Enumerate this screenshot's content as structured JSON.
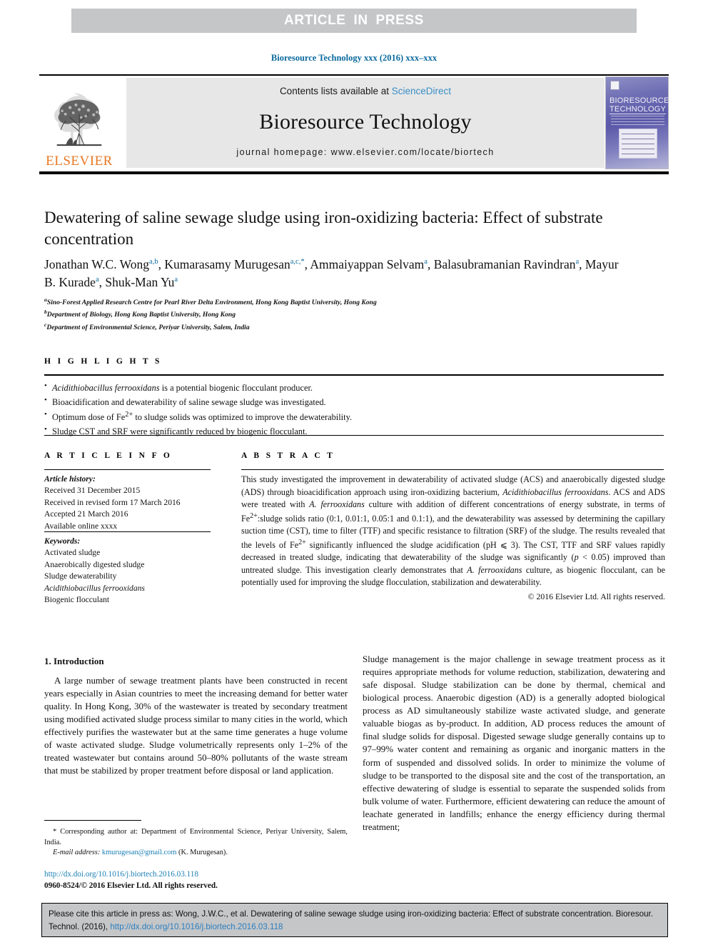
{
  "banner": {
    "text": "ARTICLE  IN  PRESS",
    "bg_color": "#c5c6c8"
  },
  "journal_ref": {
    "text": "Bioresource Technology xxx (2016) xxx–xxx",
    "color": "#0b6a9e"
  },
  "masthead": {
    "publisher_name": "ELSEVIER",
    "publisher_color": "#e87722",
    "contents_prefix": "Contents lists available at ",
    "contents_link": "ScienceDirect",
    "journal_title": "Bioresource Technology",
    "homepage": "journal homepage: www.elsevier.com/locate/biortech",
    "cover": {
      "line1": "BIORESOURCE",
      "line2": "TECHNOLOGY"
    }
  },
  "article": {
    "title": "Dewatering of saline sewage sludge using iron-oxidizing bacteria: Effect of substrate concentration",
    "authors": [
      {
        "name": "Jonathan W.C. Wong",
        "marks": "a,b",
        "sep": ", "
      },
      {
        "name": "Kumarasamy Murugesan",
        "marks": "a,c,*",
        "sep": ", "
      },
      {
        "name": "Ammaiyappan Selvam",
        "marks": "a",
        "sep": ", "
      },
      {
        "name": "Balasubramanian Ravindran",
        "marks": "a",
        "sep": ", "
      },
      {
        "name": "Mayur B. Kurade",
        "marks": "a",
        "sep": ", "
      },
      {
        "name": "Shuk-Man Yu",
        "marks": "a",
        "sep": ""
      }
    ],
    "affiliations": [
      {
        "mark": "a",
        "text": "Sino-Forest Applied Research Centre for Pearl River Delta Environment, Hong Kong Baptist University, Hong Kong"
      },
      {
        "mark": "b",
        "text": "Department of Biology, Hong Kong Baptist University, Hong Kong"
      },
      {
        "mark": "c",
        "text": "Department of Environmental Science, Periyar University, Salem, India"
      }
    ]
  },
  "highlights": {
    "heading": "H I G H L I G H T S",
    "items": [
      {
        "italic_lead": "Acidithiobacillus ferrooxidans",
        "rest": " is a potential biogenic flocculant producer."
      },
      {
        "italic_lead": "",
        "rest": "Bioacidification and dewaterability of saline sewage sludge was investigated."
      },
      {
        "italic_lead": "",
        "rest": "Optimum dose of Fe2+ to sludge solids was optimized to improve the dewaterability."
      },
      {
        "italic_lead": "",
        "rest": "Sludge CST and SRF were significantly reduced by biogenic flocculant."
      }
    ]
  },
  "article_info": {
    "heading": "A R T I C L E    I N F O",
    "history_label": "Article history:",
    "history": [
      "Received 31 December 2015",
      "Received in revised form 17 March 2016",
      "Accepted 21 March 2016",
      "Available online xxxx"
    ],
    "keywords_label": "Keywords:",
    "keywords": [
      "Activated sludge",
      "Anaerobically digested sludge",
      "Sludge dewaterability",
      "Acidithiobacillus ferrooxidans",
      "Biogenic flocculant"
    ],
    "italic_keyword": "Acidithiobacillus ferrooxidans"
  },
  "abstract": {
    "heading": "A B S T R A C T",
    "copyright": "© 2016 Elsevier Ltd. All rights reserved."
  },
  "introduction": {
    "section_title": "1. Introduction",
    "left_text": "A large number of sewage treatment plants have been constructed in recent years especially in Asian countries to meet the increasing demand for better water quality. In Hong Kong, 30% of the wastewater is treated by secondary treatment using modified activated sludge process similar to many cities in the world, which effectively purifies the wastewater but at the same time generates a huge volume of waste activated sludge. Sludge volumetrically represents only 1–2% of the treated wastewater but contains around 50–80% pollutants of the waste stream that must be stabilized by proper treatment before disposal or land application.",
    "right_text": "Sludge management is the major challenge in sewage treatment process as it requires appropriate methods for volume reduction, stabilization, dewatering and safe disposal. Sludge stabilization can be done by thermal, chemical and biological process. Anaerobic digestion (AD) is a generally adopted biological process as AD simultaneously stabilize waste activated sludge, and generate valuable biogas as by-product. In addition, AD process reduces the amount of final sludge solids for disposal. Digested sewage sludge generally contains up to 97–99% water content and remaining as organic and inorganic matters in the form of suspended and dissolved solids. In order to minimize the volume of sludge to be transported to the disposal site and the cost of the transportation, an effective dewatering of sludge is essential to separate the suspended solids from bulk volume of water. Furthermore, efficient dewatering can reduce the amount of leachate generated in landfills; enhance the energy efficiency during thermal treatment;"
  },
  "footnote": {
    "corresponding": "* Corresponding author at: Department of Environmental Science, Periyar University, Salem, India.",
    "email_label": "E-mail address:",
    "email": "kmurugesan@gmail.com",
    "email_owner": "(K. Murugesan).",
    "doi": "http://dx.doi.org/10.1016/j.biortech.2016.03.118",
    "issn_line": "0960-8524/© 2016 Elsevier Ltd. All rights reserved."
  },
  "cite_box": {
    "text": "Please cite this article in press as: Wong, J.W.C., et al. Dewatering of saline sewage sludge using iron-oxidizing bacteria: Effect of substrate concentration. Bioresour. Technol. (2016), ",
    "link": "http://dx.doi.org/10.1016/j.biortech.2016.03.118"
  },
  "colors": {
    "link_blue": "#1a7fb5",
    "sciencedirect_blue": "#3a8ec4",
    "elsevier_orange": "#e87722",
    "banner_gray": "#c5c6c8"
  }
}
